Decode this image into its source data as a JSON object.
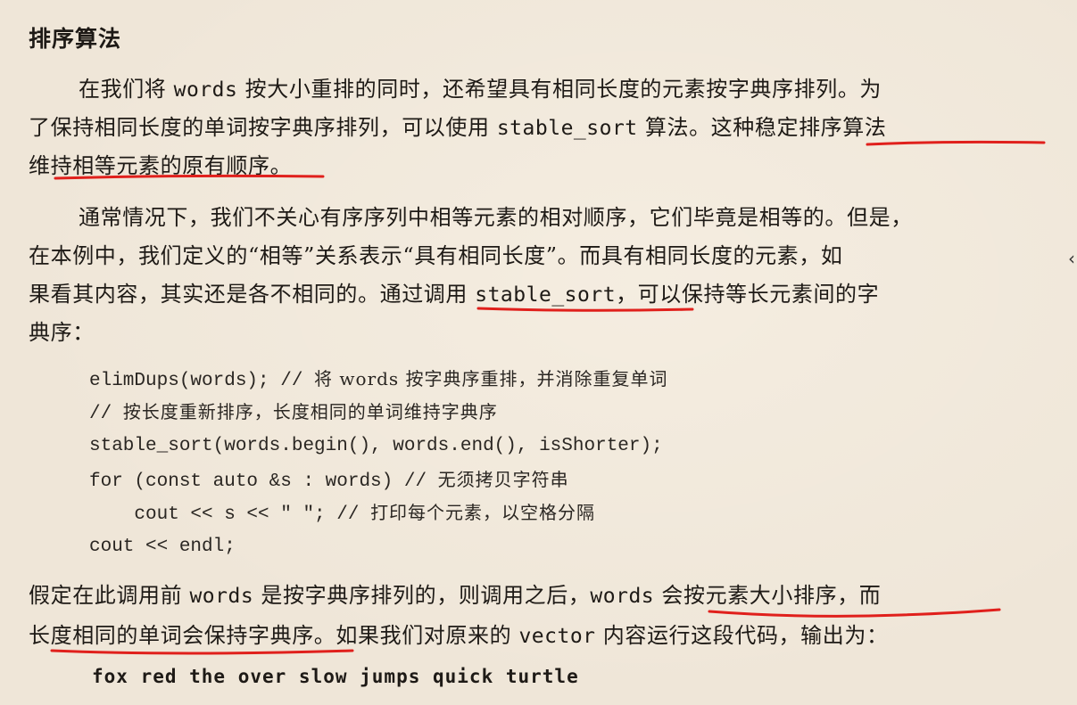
{
  "section": {
    "title": "排序算法"
  },
  "para1": {
    "l1a": "在我们将 ",
    "l1b": "words",
    "l1c": " 按大小重排的同时，还希望具有相同长度的元素按字典序排列。为",
    "l2a": "了保持相同长度的单词按字典序排列，可以使用 ",
    "l2b": "stable_sort",
    "l2c": " 算法。这种稳定排序算法",
    "l3": "维持相等元素的原有顺序。"
  },
  "para2": {
    "l1": "通常情况下，我们不关心有序序列中相等元素的相对顺序，它们毕竟是相等的。但是，",
    "l2": "在本例中，我们定义的“相等”关系表示“具有相同长度”。而具有相同长度的元素，如",
    "l3a": "果看其内容，其实还是各不相同的。通过调用 ",
    "l3b": "stable_sort",
    "l3c": "，可以保持等长元素间的字",
    "l4": "典序："
  },
  "code": {
    "c1_code": "elimDups(words); // ",
    "c1_cmt": "将 words 按字典序重排，并消除重复单词",
    "c2_code": "// ",
    "c2_cmt": "按长度重新排序，长度相同的单词维持字典序",
    "c3_code": "stable_sort(words.begin(), words.end(), isShorter);",
    "c4_code": "for (const auto &s : words) // ",
    "c4_cmt": "无须拷贝字符串",
    "c5_code": "    cout << s << \" \"; // ",
    "c5_cmt": "打印每个元素，以空格分隔",
    "c6_code": "cout << endl;"
  },
  "para3": {
    "l1a": "假定在此调用前 ",
    "l1b": "words",
    "l1c": " 是按字典序排列的，则调用之后，",
    "l1d": "words",
    "l1e": " 会按元素大小排序，而",
    "l2a": "长度相同的单词会保持字典序。如果我们对原来的 ",
    "l2b": "vector",
    "l2c": " 内容运行这段代码，输出为："
  },
  "output": {
    "text": "fox red the over slow jumps quick turtle"
  },
  "colors": {
    "underline": "#e0201c",
    "background": "#efe6d8",
    "text": "#1e1a16"
  }
}
